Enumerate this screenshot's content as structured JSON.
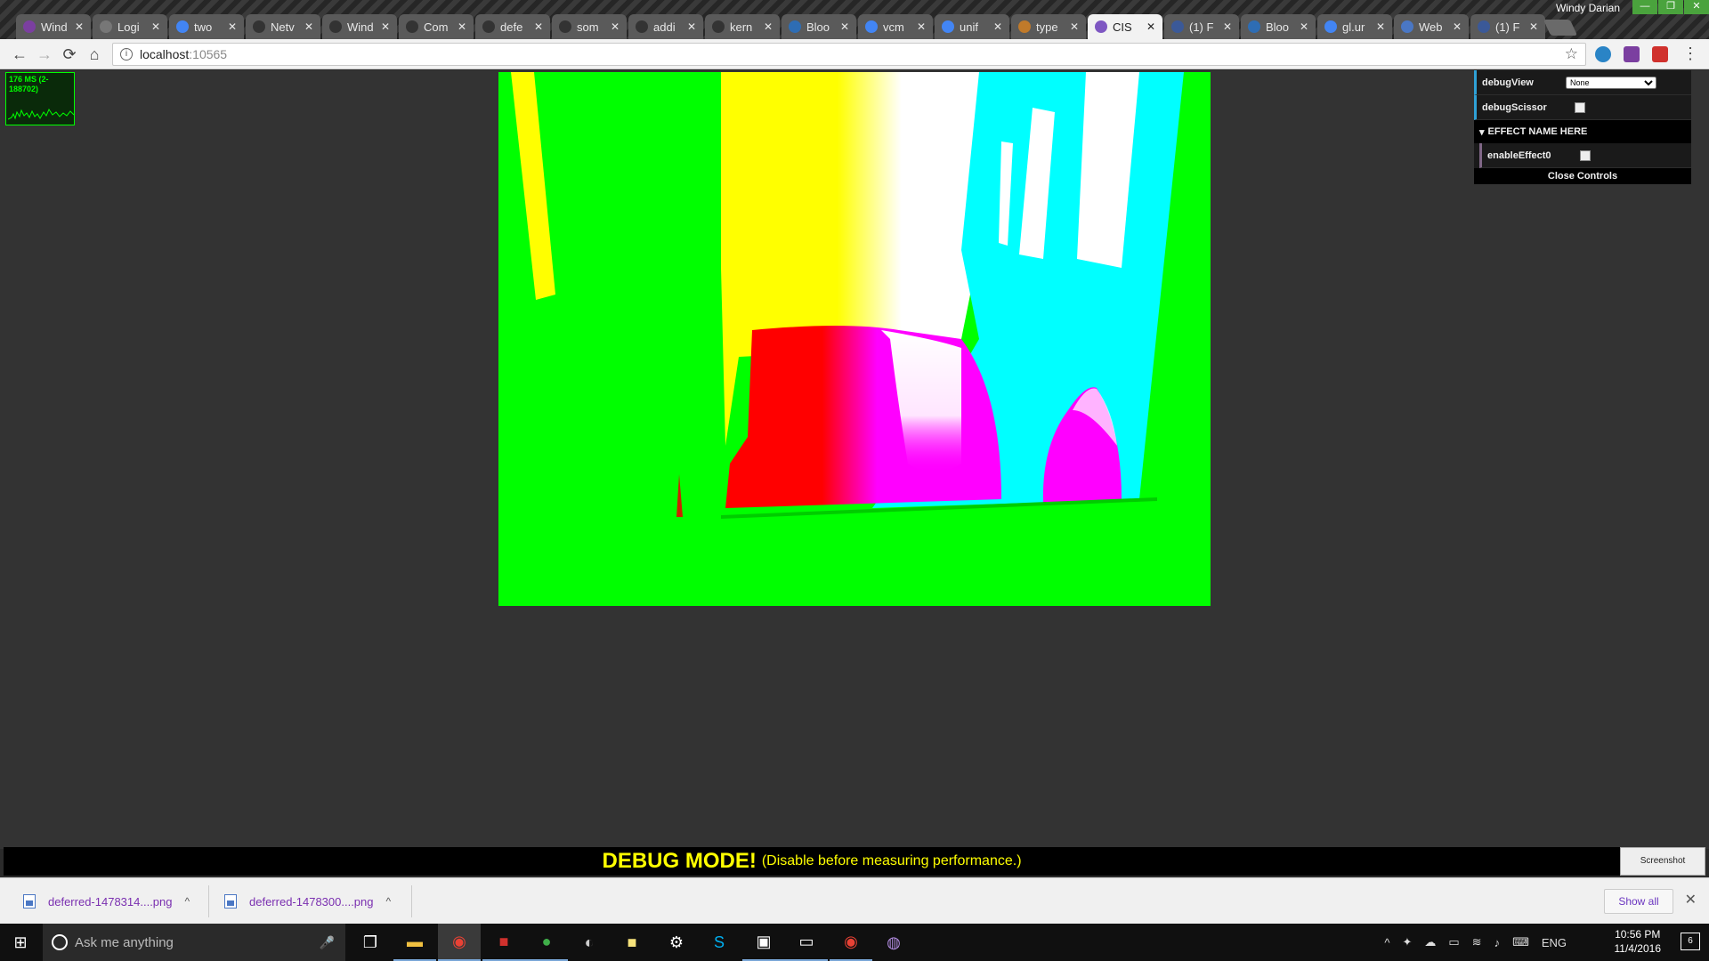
{
  "window": {
    "profile_name": "Windy Darian",
    "buttons": [
      "—",
      "❐",
      "✕"
    ]
  },
  "tabs": [
    {
      "label": "Wind",
      "icon_color": "#7b3fa0"
    },
    {
      "label": "Logi",
      "icon_color": "#777777"
    },
    {
      "label": "two",
      "icon_color": "#4285f4"
    },
    {
      "label": "Netv",
      "icon_color": "#333333"
    },
    {
      "label": "Wind",
      "icon_color": "#333333"
    },
    {
      "label": "Com",
      "icon_color": "#333333"
    },
    {
      "label": "defe",
      "icon_color": "#333333"
    },
    {
      "label": "som",
      "icon_color": "#333333"
    },
    {
      "label": "addi",
      "icon_color": "#333333"
    },
    {
      "label": "kern",
      "icon_color": "#333333"
    },
    {
      "label": "Bloo",
      "icon_color": "#2e6db4"
    },
    {
      "label": "vcm",
      "icon_color": "#4285f4"
    },
    {
      "label": "unif",
      "icon_color": "#4285f4"
    },
    {
      "label": "type",
      "icon_color": "#c07a2a"
    },
    {
      "label": "CIS",
      "icon_color": "#7e57c2",
      "active": true
    },
    {
      "label": "(1) F",
      "icon_color": "#3b5998"
    },
    {
      "label": "Bloo",
      "icon_color": "#2e6db4"
    },
    {
      "label": "gl.ur",
      "icon_color": "#4285f4"
    },
    {
      "label": "Web",
      "icon_color": "#4a77c4"
    },
    {
      "label": "(1) F",
      "icon_color": "#3b5998"
    }
  ],
  "toolbar": {
    "url_host": "localhost",
    "url_port": ":10565",
    "back_glyph": "←",
    "forward_glyph": "→",
    "reload_glyph": "⟳",
    "home_glyph": "⌂"
  },
  "stats": {
    "text": "176 MS (2-188702)"
  },
  "gui": {
    "debug_view_label": "debugView",
    "debug_view_value": "None",
    "debug_scissor_label": "debugScissor",
    "folder_label": "EFFECT NAME HERE",
    "enable_effect_label": "enableEffect0",
    "close_label": "Close Controls"
  },
  "debug_bar": {
    "title": "DEBUG MODE!",
    "subtitle": "(Disable before measuring performance.)",
    "screenshot_label": "Screenshot"
  },
  "downloads": {
    "items": [
      {
        "name": "deferred-1478314....png"
      },
      {
        "name": "deferred-1478300....png"
      }
    ],
    "show_all_label": "Show all",
    "close_glyph": "✕"
  },
  "taskbar": {
    "search_placeholder": "Ask me anything",
    "language": "ENG",
    "time": "10:56 PM",
    "date": "11/4/2016",
    "notification_count": "6"
  },
  "colors": {
    "accent_gui": "#2fa1d6",
    "debug_text": "#ffff00",
    "download_link": "#7a2fb0"
  }
}
